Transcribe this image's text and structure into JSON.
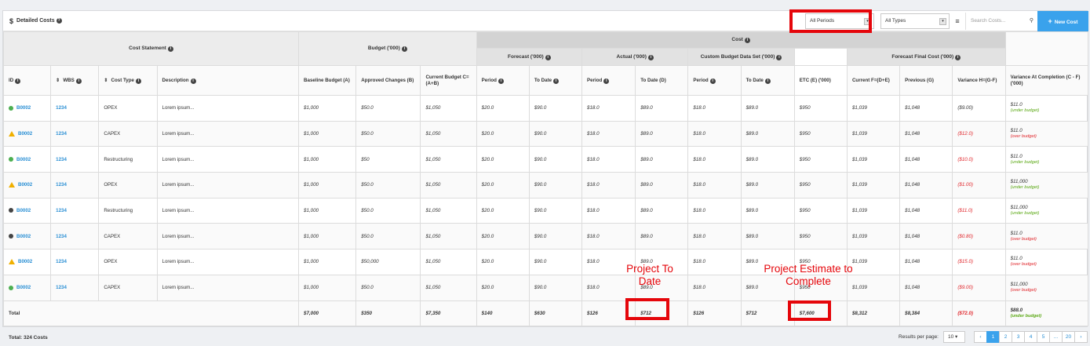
{
  "toolbar": {
    "title": "Detailed Costs",
    "period_select": "All Periods",
    "type_select": "All Types",
    "search_placeholder": "Search Costs...",
    "new_cost_label": "New Cost"
  },
  "groups": {
    "cost_statement": "Cost Statement",
    "budget": "Budget ('000)",
    "cost": "Cost",
    "forecast": "Forecast ('000)",
    "actual": "Actual ('000)",
    "custom": "Custom Budget Data Set ('000)",
    "forecast_final": "Forecast Final Cost ('000)"
  },
  "columns": {
    "id": "ID",
    "wbs": "WBS",
    "cost_type": "Cost Type",
    "description": "Description",
    "baseline": "Baseline Budget (A)",
    "approved": "Approved Changes (B)",
    "current_budget": "Current Budget C=(A+B)",
    "f_period": "Period",
    "f_todate": "To Date",
    "a_period": "Period",
    "a_todate": "To Date (D)",
    "c_period": "Period",
    "c_todate": "To Date",
    "etc": "ETC (E) ('000)",
    "ffc_current": "Current F=(D+E)",
    "ffc_previous": "Previous (G)",
    "variance": "Variance H=(G-F)",
    "vac": "Variance At Completion (C - F) ('000)"
  },
  "rows": [
    {
      "status": "ok",
      "id": "B0002",
      "wbs": "1234",
      "type": "OPEX",
      "desc": "Lorem ipsum...",
      "baseline": "$1,000",
      "approved": "$50.0",
      "current": "$1,050",
      "fp": "$20.0",
      "ft": "$90.0",
      "ap": "$18.0",
      "at": "$89.0",
      "cp": "$18.0",
      "ct": "$89.0",
      "etc": "$950",
      "cur": "$1,039",
      "prev": "$1,048",
      "var": "($9.00)",
      "var_neg": false,
      "vac": "$11.0",
      "vac_note": "(under budget)",
      "vac_under": true
    },
    {
      "status": "warn",
      "id": "B0002",
      "wbs": "1234",
      "type": "CAPEX",
      "desc": "Lorem ipsum...",
      "baseline": "$1,000",
      "approved": "$50.0",
      "current": "$1,050",
      "fp": "$20.0",
      "ft": "$90.0",
      "ap": "$18.0",
      "at": "$89.0",
      "cp": "$18.0",
      "ct": "$89.0",
      "etc": "$950",
      "cur": "$1,039",
      "prev": "$1,048",
      "var": "($12.0)",
      "var_neg": true,
      "vac": "$11.0",
      "vac_note": "(over budget)",
      "vac_under": false
    },
    {
      "status": "ok",
      "id": "B0002",
      "wbs": "1234",
      "type": "Restructuring",
      "desc": "Lorem ipsum...",
      "baseline": "$1,000",
      "approved": "$50",
      "current": "$1,050",
      "fp": "$20.0",
      "ft": "$90.0",
      "ap": "$18.0",
      "at": "$89.0",
      "cp": "$18.0",
      "ct": "$89.0",
      "etc": "$950",
      "cur": "$1,039",
      "prev": "$1,048",
      "var": "($10.0)",
      "var_neg": true,
      "vac": "$11.0",
      "vac_note": "(under budget)",
      "vac_under": true
    },
    {
      "status": "warn",
      "id": "B0002",
      "wbs": "1234",
      "type": "OPEX",
      "desc": "Lorem ipsum...",
      "baseline": "$1,000",
      "approved": "$50.0",
      "current": "$1,050",
      "fp": "$20.0",
      "ft": "$90.0",
      "ap": "$18.0",
      "at": "$89.0",
      "cp": "$18.0",
      "ct": "$89.0",
      "etc": "$950",
      "cur": "$1,039",
      "prev": "$1,048",
      "var": "($1.00)",
      "var_neg": true,
      "vac": "$11,000",
      "vac_note": "(under budget)",
      "vac_under": true
    },
    {
      "status": "minus",
      "id": "B0002",
      "wbs": "1234",
      "type": "Restructuring",
      "desc": "Lorem ipsum...",
      "baseline": "$1,000",
      "approved": "$50.0",
      "current": "$1,050",
      "fp": "$20.0",
      "ft": "$90.0",
      "ap": "$18.0",
      "at": "$89.0",
      "cp": "$18.0",
      "ct": "$89.0",
      "etc": "$950",
      "cur": "$1,039",
      "prev": "$1,048",
      "var": "($11.0)",
      "var_neg": true,
      "vac": "$11,000",
      "vac_note": "(under budget)",
      "vac_under": true
    },
    {
      "status": "minus",
      "id": "B0002",
      "wbs": "1234",
      "type": "CAPEX",
      "desc": "Lorem ipsum...",
      "baseline": "$1,000",
      "approved": "$50.0",
      "current": "$1,050",
      "fp": "$20.0",
      "ft": "$90.0",
      "ap": "$18.0",
      "at": "$89.0",
      "cp": "$18.0",
      "ct": "$89.0",
      "etc": "$950",
      "cur": "$1,039",
      "prev": "$1,048",
      "var": "($0.80)",
      "var_neg": true,
      "vac": "$11.0",
      "vac_note": "(over budget)",
      "vac_under": false
    },
    {
      "status": "warn",
      "id": "B0002",
      "wbs": "1234",
      "type": "OPEX",
      "desc": "Lorem ipsum...",
      "baseline": "$1,000",
      "approved": "$50,000",
      "current": "$1,050",
      "fp": "$20.0",
      "ft": "$90.0",
      "ap": "$18.0",
      "at": "$89.0",
      "cp": "$18.0",
      "ct": "$89.0",
      "etc": "$950",
      "cur": "$1,039",
      "prev": "$1,048",
      "var": "($15.0)",
      "var_neg": true,
      "vac": "$11.0",
      "vac_note": "(over budget)",
      "vac_under": false
    },
    {
      "status": "ok",
      "id": "B0002",
      "wbs": "1234",
      "type": "CAPEX",
      "desc": "Lorem ipsum...",
      "baseline": "$1,000",
      "approved": "$50.0",
      "current": "$1,050",
      "fp": "$20.0",
      "ft": "$90.0",
      "ap": "$18.0",
      "at": "$89.0",
      "cp": "$18.0",
      "ct": "$89.0",
      "etc": "$950",
      "cur": "$1,039",
      "prev": "$1,048",
      "var": "($9.00)",
      "var_neg": true,
      "vac": "$11,000",
      "vac_note": "(over budget)",
      "vac_under": false
    }
  ],
  "total": {
    "label": "Total",
    "baseline": "$7,000",
    "approved": "$350",
    "current": "$7,350",
    "fp": "$140",
    "ft": "$630",
    "ap": "$126",
    "at": "$712",
    "cp": "$126",
    "ct": "$712",
    "etc": "$7,600",
    "cur": "$8,312",
    "prev": "$8,384",
    "var": "($72.0)",
    "vac": "$88.0",
    "vac_note": "(under budget)"
  },
  "footer": {
    "total_costs": "Total: 324 Costs",
    "results_per_page_label": "Results per page:",
    "results_per_page": "10",
    "pages": [
      "1",
      "2",
      "3",
      "4",
      "5",
      "...",
      "20"
    ]
  },
  "annotations": {
    "project_to_date": "Project To Date",
    "project_etc": "Project Estimate to Complete"
  },
  "colors": {
    "highlight": "#e5060b",
    "accent": "#3aa2ec",
    "link": "#2a8fd4",
    "negative": "#e0262b",
    "under_budget": "#5aa813"
  }
}
